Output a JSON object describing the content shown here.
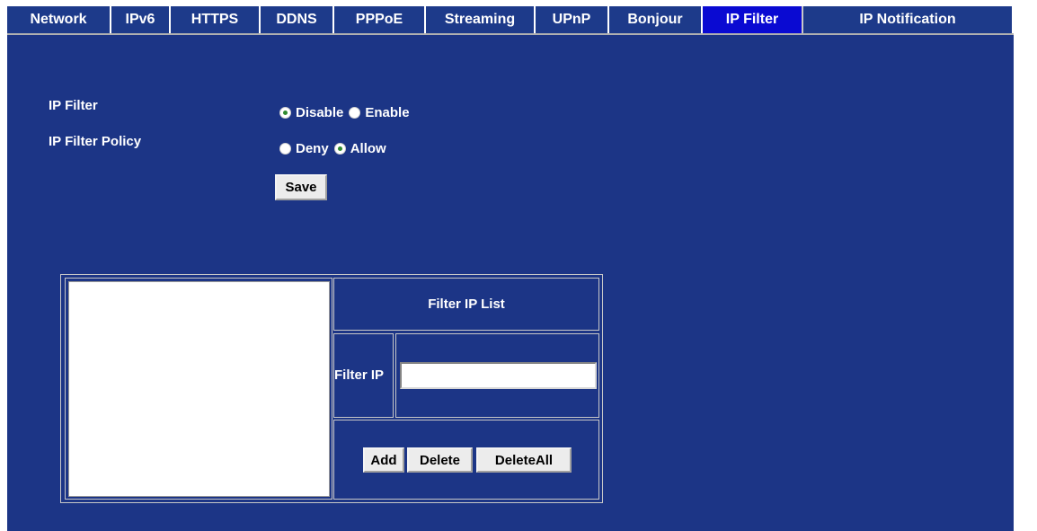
{
  "tabs": [
    {
      "label": "Network",
      "active": false
    },
    {
      "label": "IPv6",
      "active": false
    },
    {
      "label": "HTTPS",
      "active": false
    },
    {
      "label": "DDNS",
      "active": false
    },
    {
      "label": "PPPoE",
      "active": false
    },
    {
      "label": "Streaming",
      "active": false
    },
    {
      "label": "UPnP",
      "active": false
    },
    {
      "label": "Bonjour",
      "active": false
    },
    {
      "label": "IP Filter",
      "active": true
    },
    {
      "label": "IP Notification",
      "active": false
    }
  ],
  "settings": {
    "ip_filter": {
      "label": "IP Filter",
      "options": [
        {
          "label": "Disable",
          "checked": true
        },
        {
          "label": "Enable",
          "checked": false
        }
      ]
    },
    "ip_filter_policy": {
      "label": "IP Filter Policy",
      "options": [
        {
          "label": "Deny",
          "checked": false
        },
        {
          "label": "Allow",
          "checked": true
        }
      ]
    },
    "save_label": "Save"
  },
  "filter_list": {
    "title": "Filter IP List",
    "ip_label": "Filter IP",
    "ip_value": "",
    "entries": [],
    "add_label": "Add",
    "delete_label": "Delete",
    "delete_all_label": "DeleteAll"
  },
  "colors": {
    "panel_bg": "#1c3586",
    "tab_bg": "#1d3a8a",
    "active_tab_bg": "#0a0ad2"
  }
}
